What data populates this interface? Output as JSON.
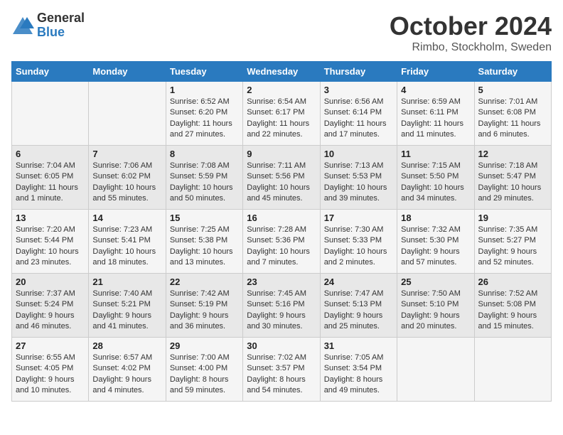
{
  "logo": {
    "general": "General",
    "blue": "Blue"
  },
  "title": "October 2024",
  "location": "Rimbo, Stockholm, Sweden",
  "headers": [
    "Sunday",
    "Monday",
    "Tuesday",
    "Wednesday",
    "Thursday",
    "Friday",
    "Saturday"
  ],
  "weeks": [
    [
      {
        "day": "",
        "content": ""
      },
      {
        "day": "",
        "content": ""
      },
      {
        "day": "1",
        "content": "Sunrise: 6:52 AM\nSunset: 6:20 PM\nDaylight: 11 hours and 27 minutes."
      },
      {
        "day": "2",
        "content": "Sunrise: 6:54 AM\nSunset: 6:17 PM\nDaylight: 11 hours and 22 minutes."
      },
      {
        "day": "3",
        "content": "Sunrise: 6:56 AM\nSunset: 6:14 PM\nDaylight: 11 hours and 17 minutes."
      },
      {
        "day": "4",
        "content": "Sunrise: 6:59 AM\nSunset: 6:11 PM\nDaylight: 11 hours and 11 minutes."
      },
      {
        "day": "5",
        "content": "Sunrise: 7:01 AM\nSunset: 6:08 PM\nDaylight: 11 hours and 6 minutes."
      }
    ],
    [
      {
        "day": "6",
        "content": "Sunrise: 7:04 AM\nSunset: 6:05 PM\nDaylight: 11 hours and 1 minute."
      },
      {
        "day": "7",
        "content": "Sunrise: 7:06 AM\nSunset: 6:02 PM\nDaylight: 10 hours and 55 minutes."
      },
      {
        "day": "8",
        "content": "Sunrise: 7:08 AM\nSunset: 5:59 PM\nDaylight: 10 hours and 50 minutes."
      },
      {
        "day": "9",
        "content": "Sunrise: 7:11 AM\nSunset: 5:56 PM\nDaylight: 10 hours and 45 minutes."
      },
      {
        "day": "10",
        "content": "Sunrise: 7:13 AM\nSunset: 5:53 PM\nDaylight: 10 hours and 39 minutes."
      },
      {
        "day": "11",
        "content": "Sunrise: 7:15 AM\nSunset: 5:50 PM\nDaylight: 10 hours and 34 minutes."
      },
      {
        "day": "12",
        "content": "Sunrise: 7:18 AM\nSunset: 5:47 PM\nDaylight: 10 hours and 29 minutes."
      }
    ],
    [
      {
        "day": "13",
        "content": "Sunrise: 7:20 AM\nSunset: 5:44 PM\nDaylight: 10 hours and 23 minutes."
      },
      {
        "day": "14",
        "content": "Sunrise: 7:23 AM\nSunset: 5:41 PM\nDaylight: 10 hours and 18 minutes."
      },
      {
        "day": "15",
        "content": "Sunrise: 7:25 AM\nSunset: 5:38 PM\nDaylight: 10 hours and 13 minutes."
      },
      {
        "day": "16",
        "content": "Sunrise: 7:28 AM\nSunset: 5:36 PM\nDaylight: 10 hours and 7 minutes."
      },
      {
        "day": "17",
        "content": "Sunrise: 7:30 AM\nSunset: 5:33 PM\nDaylight: 10 hours and 2 minutes."
      },
      {
        "day": "18",
        "content": "Sunrise: 7:32 AM\nSunset: 5:30 PM\nDaylight: 9 hours and 57 minutes."
      },
      {
        "day": "19",
        "content": "Sunrise: 7:35 AM\nSunset: 5:27 PM\nDaylight: 9 hours and 52 minutes."
      }
    ],
    [
      {
        "day": "20",
        "content": "Sunrise: 7:37 AM\nSunset: 5:24 PM\nDaylight: 9 hours and 46 minutes."
      },
      {
        "day": "21",
        "content": "Sunrise: 7:40 AM\nSunset: 5:21 PM\nDaylight: 9 hours and 41 minutes."
      },
      {
        "day": "22",
        "content": "Sunrise: 7:42 AM\nSunset: 5:19 PM\nDaylight: 9 hours and 36 minutes."
      },
      {
        "day": "23",
        "content": "Sunrise: 7:45 AM\nSunset: 5:16 PM\nDaylight: 9 hours and 30 minutes."
      },
      {
        "day": "24",
        "content": "Sunrise: 7:47 AM\nSunset: 5:13 PM\nDaylight: 9 hours and 25 minutes."
      },
      {
        "day": "25",
        "content": "Sunrise: 7:50 AM\nSunset: 5:10 PM\nDaylight: 9 hours and 20 minutes."
      },
      {
        "day": "26",
        "content": "Sunrise: 7:52 AM\nSunset: 5:08 PM\nDaylight: 9 hours and 15 minutes."
      }
    ],
    [
      {
        "day": "27",
        "content": "Sunrise: 6:55 AM\nSunset: 4:05 PM\nDaylight: 9 hours and 10 minutes."
      },
      {
        "day": "28",
        "content": "Sunrise: 6:57 AM\nSunset: 4:02 PM\nDaylight: 9 hours and 4 minutes."
      },
      {
        "day": "29",
        "content": "Sunrise: 7:00 AM\nSunset: 4:00 PM\nDaylight: 8 hours and 59 minutes."
      },
      {
        "day": "30",
        "content": "Sunrise: 7:02 AM\nSunset: 3:57 PM\nDaylight: 8 hours and 54 minutes."
      },
      {
        "day": "31",
        "content": "Sunrise: 7:05 AM\nSunset: 3:54 PM\nDaylight: 8 hours and 49 minutes."
      },
      {
        "day": "",
        "content": ""
      },
      {
        "day": "",
        "content": ""
      }
    ]
  ]
}
